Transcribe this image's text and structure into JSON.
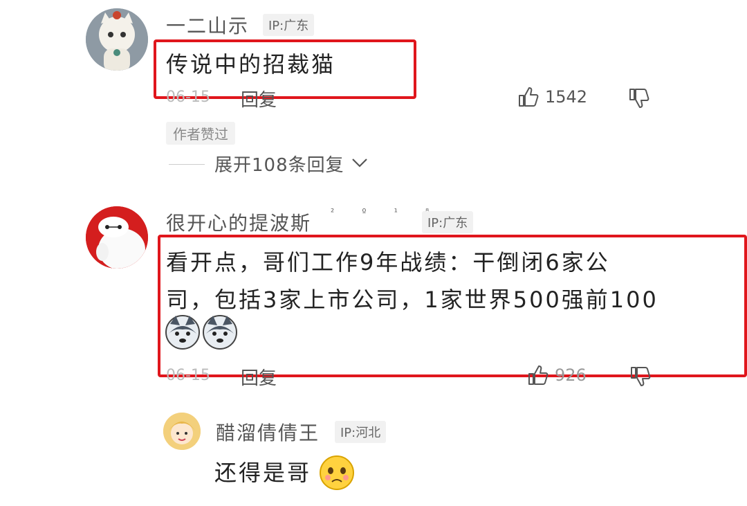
{
  "comments": [
    {
      "username": "一二山示",
      "ip": "IP:广东",
      "text": "传说中的招裁猫",
      "date": "06-15",
      "reply_label": "回复",
      "likes": "1542",
      "author_liked_tag": "作者赞过",
      "expand_label": "展开108条回复"
    },
    {
      "username": "很开心的提波斯",
      "badge_chars": "² º ¹ ⁸",
      "ip": "IP:广东",
      "text_line1": "看开点，哥们工作9年战绩：干倒闭6家公",
      "text_line2": "司，包括3家上市公司，1家世界500强前100",
      "date": "06-15",
      "reply_label": "回复",
      "likes": "926",
      "replies": [
        {
          "username": "醋溜倩倩王",
          "ip": "IP:河北",
          "text": "还得是哥"
        }
      ]
    }
  ],
  "colors": {
    "highlight_box": "#e0161c",
    "ip_tag_bg": "#f1f1f1"
  },
  "icons": [
    "thumbs-up-icon",
    "thumbs-down-icon",
    "chevron-down-icon",
    "husky-emoji-icon",
    "shy-face-emoji-icon"
  ]
}
